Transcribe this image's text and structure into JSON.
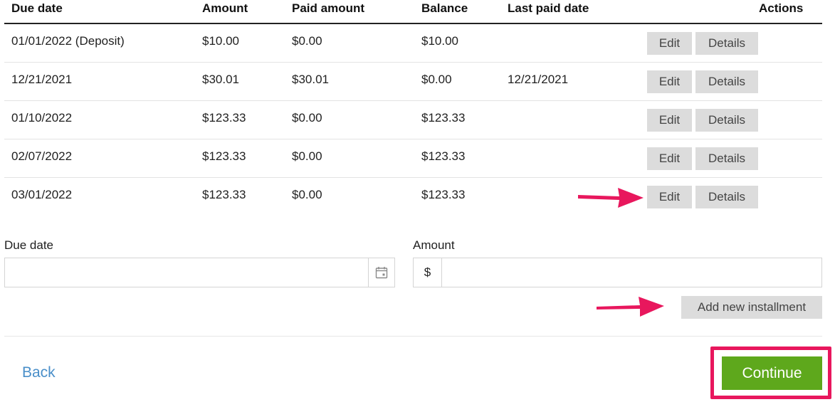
{
  "table": {
    "headers": {
      "due_date": "Due date",
      "amount": "Amount",
      "paid_amount": "Paid amount",
      "balance": "Balance",
      "last_paid_date": "Last paid date",
      "actions": "Actions"
    },
    "rows": [
      {
        "due_date": "01/01/2022 (Deposit)",
        "amount": "$10.00",
        "paid_amount": "$0.00",
        "balance": "$10.00",
        "last_paid_date": "",
        "edit_label": "Edit",
        "details_label": "Details"
      },
      {
        "due_date": "12/21/2021",
        "amount": "$30.01",
        "paid_amount": "$30.01",
        "balance": "$0.00",
        "last_paid_date": "12/21/2021",
        "edit_label": "Edit",
        "details_label": "Details"
      },
      {
        "due_date": "01/10/2022",
        "amount": "$123.33",
        "paid_amount": "$0.00",
        "balance": "$123.33",
        "last_paid_date": "",
        "edit_label": "Edit",
        "details_label": "Details"
      },
      {
        "due_date": "02/07/2022",
        "amount": "$123.33",
        "paid_amount": "$0.00",
        "balance": "$123.33",
        "last_paid_date": "",
        "edit_label": "Edit",
        "details_label": "Details"
      },
      {
        "due_date": "03/01/2022",
        "amount": "$123.33",
        "paid_amount": "$0.00",
        "balance": "$123.33",
        "last_paid_date": "",
        "edit_label": "Edit",
        "details_label": "Details"
      }
    ]
  },
  "form": {
    "due_date_label": "Due date",
    "due_date_value": "",
    "due_date_icon": "calendar-icon",
    "amount_label": "Amount",
    "currency_symbol": "$",
    "amount_value": "",
    "add_button_label": "Add new installment"
  },
  "footer": {
    "back_label": "Back",
    "continue_label": "Continue"
  },
  "colors": {
    "accent_green": "#5ea81c",
    "annotation_pink": "#e8175d",
    "link_blue": "#4a8fc9",
    "button_grey": "#dcdcdc"
  }
}
